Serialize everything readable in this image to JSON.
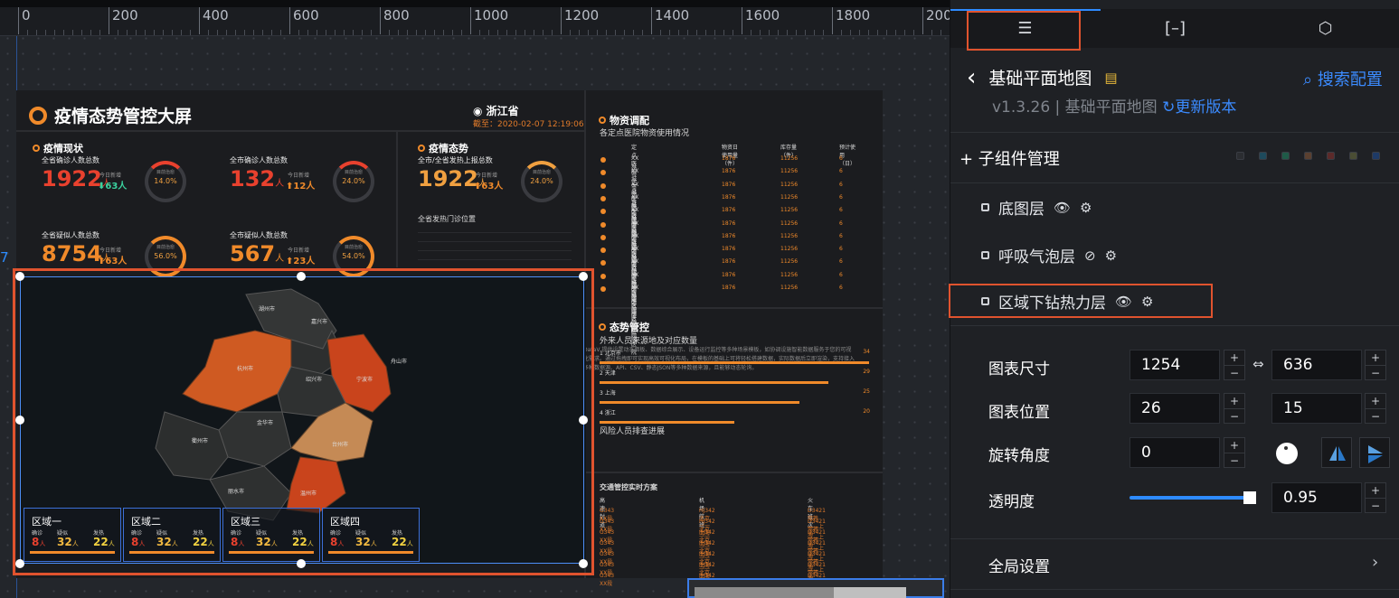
{
  "ruler": {
    "ticks": [
      "0",
      "200",
      "400",
      "600",
      "800",
      "1000",
      "1200",
      "1400",
      "1600",
      "1800",
      "2000"
    ]
  },
  "guide_number": "7",
  "dashboard": {
    "title": "疫情态势管控大屏",
    "location": "浙江省",
    "date": "截至：2020-02-07 12:19:06",
    "sections": {
      "status": "疫情现状",
      "trend": "疫情态势",
      "supplies": "物资调配",
      "supplies_sub": "各定点医院物资使用情况",
      "control": "态势管控",
      "control_sub": "外来人员来源地及对应数量",
      "risk": "风险人员排查进展",
      "traffic": "交通管控实时方案",
      "clinic": "全省发热门诊位置"
    },
    "stats": [
      {
        "label": "全省确诊人数总数",
        "value": "1922",
        "unit": "人",
        "new_label": "今日新增",
        "new": "63",
        "rate": "14.0%",
        "rate_label": "目前治愈"
      },
      {
        "label": "全市确诊人数总数",
        "value": "132",
        "unit": "人",
        "new_label": "今日新增",
        "new": "12",
        "rate": "24.0%",
        "rate_label": "目前治愈"
      },
      {
        "label": "全省疑似人数总数",
        "value": "8754",
        "unit": "人",
        "new_label": "今日新增",
        "new": "63",
        "rate": "56.0%",
        "rate_label": "目前治愈"
      },
      {
        "label": "全市疑似人数总数",
        "value": "567",
        "unit": "人",
        "new_label": "今日新增",
        "new": "23",
        "rate": "54.0%",
        "rate_label": "目前治愈"
      },
      {
        "label": "全市/全省发热上报总数",
        "value": "1922",
        "unit": "人",
        "new_label": "今日新增",
        "new": "63",
        "rate": "24.0%",
        "rate_label": "目前治愈"
      }
    ],
    "supply_headers": [
      "定点医院",
      "物资日使用量（件）",
      "库存量（件）",
      "预计使用（日）"
    ],
    "supply_rows": [
      [
        "XX城市定点医院医院",
        "1876",
        "11256",
        "6"
      ],
      [
        "XX城市定点医院医院",
        "1876",
        "11256",
        "6"
      ],
      [
        "XX城市定点医院医院",
        "1876",
        "11256",
        "6"
      ],
      [
        "XX城市定点医院医院",
        "1876",
        "11256",
        "6"
      ],
      [
        "XX城市定点医院医院",
        "1876",
        "11256",
        "6"
      ],
      [
        "XX城市定点医院医院",
        "1876",
        "11256",
        "6"
      ],
      [
        "XX城市定点医院医院",
        "1876",
        "11256",
        "6"
      ],
      [
        "XX城市定点医院医院",
        "1876",
        "11256",
        "6"
      ],
      [
        "XX城市定点医院医院",
        "1876",
        "11256",
        "6"
      ],
      [
        "XX城市定点医院医院",
        "1876",
        "11256",
        "6"
      ],
      [
        "XX城市定点医院医院",
        "1876",
        "11256",
        "6"
      ]
    ],
    "ranks": [
      {
        "label": "1 北京市",
        "value": "34",
        "pct": 100
      },
      {
        "label": "2 天津",
        "value": "29",
        "pct": 85
      },
      {
        "label": "3 上海",
        "value": "25",
        "pct": 74
      },
      {
        "label": "4 浙江",
        "value": "20",
        "pct": 50
      }
    ],
    "risk_text": "DataV 提供设置动态面板、数据综合展示、设备运行监控等多种场景模板，如协调设施智能数据服务于您的可视化需求。通过拖拽即可实现高效可视化布局，在模板的基础上可将轻松搭建数据，实际数据后立即渲染，支持接入多种数据源、API、CSV、静态JSON等多种数据来源，且能够动态轮询。",
    "traffic_headers": [
      "高速封道",
      "机场航班",
      "火车班次"
    ],
    "traffic_rows": [
      [
        "G343 XX段",
        "HJ342 北京——上海",
        "D3421 常熟——上海"
      ],
      [
        "G343 XX段",
        "HJ342 北京——上海",
        "D3421 常熟——上海"
      ],
      [
        "G343 XX段",
        "HJ342 北京——上海",
        "D3421 常熟——上海"
      ],
      [
        "G343 XX段",
        "HJ342 北京——上海",
        "D3421 常熟——上海"
      ],
      [
        "G343 XX段",
        "HJ342 北京——上海",
        "D3421 常熟——上海"
      ],
      [
        "G343 XX段",
        "HJ342 北京——上海",
        "D3421 常熟——上海"
      ],
      [
        "G343 XX段",
        "HJ342 北京——上海",
        "D3421 常熟——上海"
      ]
    ],
    "map_cities": [
      "湖州市",
      "嘉兴市",
      "杭州市",
      "绍兴市",
      "宁波市",
      "舟山市",
      "金华市",
      "台州市",
      "衢州市",
      "丽水市",
      "温州市"
    ],
    "regions": [
      {
        "name": "区域一",
        "s1": "确诊",
        "s2": "疑似",
        "s3": "发热",
        "v1": "8",
        "v2": "32",
        "v3": "22",
        "unit": "人"
      },
      {
        "name": "区域二",
        "s1": "确诊",
        "s2": "疑似",
        "s3": "发热",
        "v1": "8",
        "v2": "32",
        "v3": "22",
        "unit": "人"
      },
      {
        "name": "区域三",
        "s1": "确诊",
        "s2": "疑似",
        "s3": "发热",
        "v1": "8",
        "v2": "32",
        "v3": "22",
        "unit": "人"
      },
      {
        "name": "区域四",
        "s1": "确诊",
        "s2": "疑似",
        "s3": "发热",
        "v1": "8",
        "v2": "32",
        "v3": "22",
        "unit": "人"
      }
    ]
  },
  "panel": {
    "tabs": [
      {
        "icon": "sliders-icon",
        "glyph": "☰"
      },
      {
        "icon": "bracket-icon",
        "glyph": "[–]"
      },
      {
        "icon": "interaction-icon",
        "glyph": "⬡"
      }
    ],
    "back_glyph": "‹",
    "title": "基础平面地图",
    "search": "搜索配置",
    "version": "v1.3.26 | 基础平面地图",
    "update": "更新版本",
    "children_header": "+ 子组件管理",
    "swatch_colors": [
      "#2b2d31",
      "#1e4a5c",
      "#1f5a48",
      "#5a4030",
      "#5c2a2a",
      "#4a4d34",
      "#1e3a66"
    ],
    "layers": [
      {
        "name": "底图层",
        "eye": "👁",
        "cfg": "⚙"
      },
      {
        "name": "呼吸气泡层",
        "eye": "⊘",
        "cfg": "⚙"
      },
      {
        "name": "区域下钻热力层",
        "eye": "👁",
        "cfg": "⚙"
      }
    ],
    "props": {
      "size_label": "图表尺寸",
      "width": "1254",
      "height": "636",
      "pos_label": "图表位置",
      "x": "26",
      "y": "15",
      "rotate_label": "旋转角度",
      "rotate": "0",
      "opacity_label": "透明度",
      "opacity": "0.95",
      "opacity_level": 0.95,
      "global_label": "全局设置"
    },
    "stepper": {
      "plus": "+",
      "minus": "−"
    },
    "link_glyph": "⇔",
    "arrow_glyph": "›"
  },
  "colors": {
    "accent": "#2e8bff",
    "highlight": "#e0532e",
    "orange": "#f08a2a",
    "red": "#e8412e",
    "green": "#3ad29f"
  }
}
